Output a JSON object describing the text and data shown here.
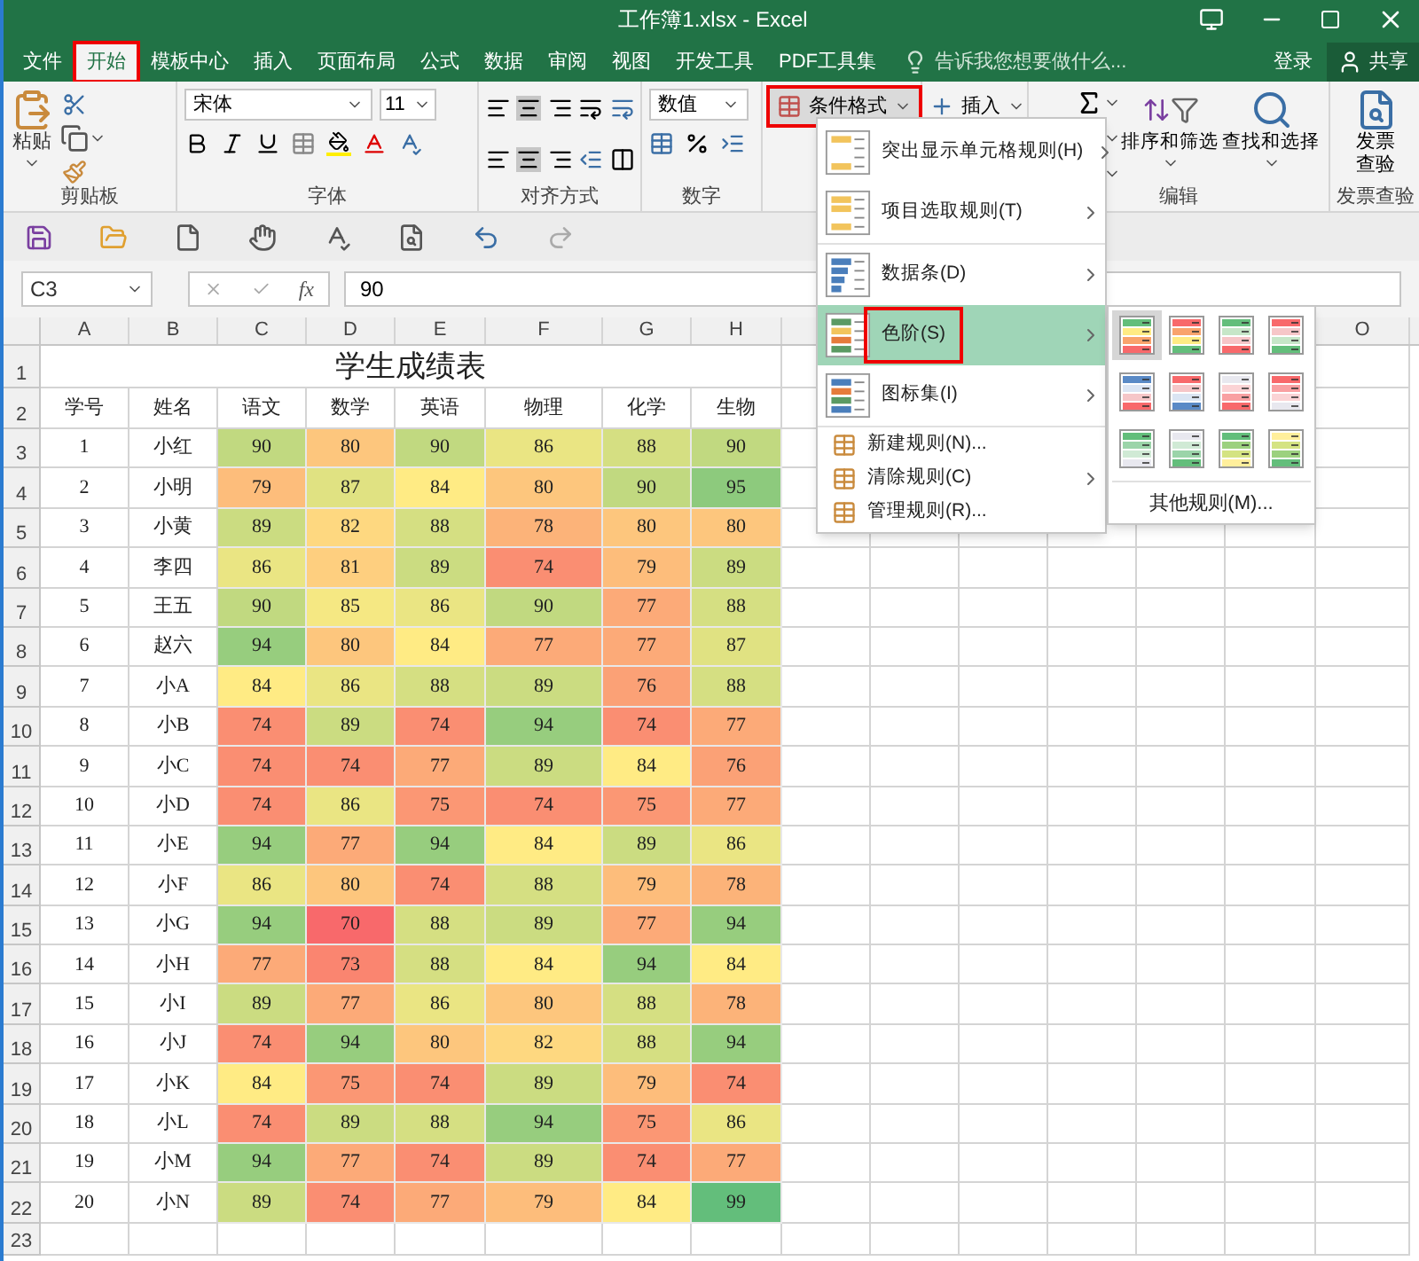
{
  "window": {
    "title": "工作簿1.xlsx - Excel"
  },
  "tabs": [
    {
      "label": "文件",
      "selected": false,
      "annotated": false
    },
    {
      "label": "开始",
      "selected": true,
      "annotated": true
    },
    {
      "label": "模板中心",
      "selected": false,
      "annotated": false
    },
    {
      "label": "插入",
      "selected": false,
      "annotated": false
    },
    {
      "label": "页面布局",
      "selected": false,
      "annotated": false
    },
    {
      "label": "公式",
      "selected": false,
      "annotated": false
    },
    {
      "label": "数据",
      "selected": false,
      "annotated": false
    },
    {
      "label": "审阅",
      "selected": false,
      "annotated": false
    },
    {
      "label": "视图",
      "selected": false,
      "annotated": false
    },
    {
      "label": "开发工具",
      "selected": false,
      "annotated": false
    },
    {
      "label": "PDF工具集",
      "selected": false,
      "annotated": false
    }
  ],
  "tell_me": {
    "placeholder": "告诉我您想要做什么..."
  },
  "account": {
    "sign_in": "登录",
    "share": "共享"
  },
  "ribbon": {
    "paste": "粘贴",
    "font_name": "宋体",
    "font_size": "11",
    "number_format": "数值",
    "conditional_formatting": {
      "label": "条件格式",
      "annotated": true
    },
    "insert": "插入",
    "sort_filter": "排序和筛选",
    "find_select": "查找和选择",
    "invoice_check": "发票查验",
    "groups": [
      "剪贴板",
      "字体",
      "对齐方式",
      "数字",
      "编辑",
      "发票查验"
    ]
  },
  "formula_bar": {
    "name_box": "C3",
    "fx": "fx",
    "value": "90"
  },
  "sheet": {
    "column_headers": [
      "A",
      "B",
      "C",
      "D",
      "E",
      "F",
      "G",
      "H",
      "O"
    ],
    "row_headers": [
      "1",
      "2",
      "3",
      "4",
      "5",
      "6",
      "7",
      "8",
      "9",
      "10",
      "11",
      "12",
      "13",
      "14",
      "15",
      "16",
      "17",
      "18",
      "19",
      "20",
      "21",
      "22",
      "23"
    ],
    "title": "学生成绩表",
    "header": [
      "学号",
      "姓名",
      "语文",
      "数学",
      "英语",
      "物理",
      "化学",
      "生物"
    ],
    "rows": [
      [
        "1",
        "小红",
        "90",
        "80",
        "90",
        "86",
        "88",
        "90"
      ],
      [
        "2",
        "小明",
        "79",
        "87",
        "84",
        "80",
        "90",
        "95"
      ],
      [
        "3",
        "小黄",
        "89",
        "82",
        "88",
        "78",
        "80",
        "80"
      ],
      [
        "4",
        "李四",
        "86",
        "81",
        "89",
        "74",
        "79",
        "89"
      ],
      [
        "5",
        "王五",
        "90",
        "85",
        "86",
        "90",
        "77",
        "88"
      ],
      [
        "6",
        "赵六",
        "94",
        "80",
        "84",
        "77",
        "77",
        "87"
      ],
      [
        "7",
        "小A",
        "84",
        "86",
        "88",
        "89",
        "76",
        "88"
      ],
      [
        "8",
        "小B",
        "74",
        "89",
        "74",
        "94",
        "74",
        "77"
      ],
      [
        "9",
        "小C",
        "74",
        "74",
        "77",
        "89",
        "84",
        "76"
      ],
      [
        "10",
        "小D",
        "74",
        "86",
        "75",
        "74",
        "75",
        "77"
      ],
      [
        "11",
        "小E",
        "94",
        "77",
        "94",
        "84",
        "89",
        "86"
      ],
      [
        "12",
        "小F",
        "86",
        "80",
        "74",
        "88",
        "79",
        "78"
      ],
      [
        "13",
        "小G",
        "94",
        "70",
        "88",
        "89",
        "77",
        "94"
      ],
      [
        "14",
        "小H",
        "77",
        "73",
        "88",
        "84",
        "94",
        "84"
      ],
      [
        "15",
        "小I",
        "89",
        "77",
        "86",
        "80",
        "88",
        "78"
      ],
      [
        "16",
        "小J",
        "74",
        "94",
        "80",
        "82",
        "88",
        "94"
      ],
      [
        "17",
        "小K",
        "84",
        "75",
        "74",
        "89",
        "79",
        "74"
      ],
      [
        "18",
        "小L",
        "74",
        "89",
        "88",
        "94",
        "75",
        "86"
      ],
      [
        "19",
        "小M",
        "94",
        "77",
        "74",
        "89",
        "74",
        "77"
      ],
      [
        "20",
        "小N",
        "89",
        "74",
        "77",
        "79",
        "84",
        "99"
      ]
    ]
  },
  "menu": {
    "items": [
      {
        "kind": "large",
        "label": "突出显示单元格规则(H)",
        "submenu": true,
        "selected": false,
        "annotated": false
      },
      {
        "kind": "large",
        "label": "项目选取规则(T)",
        "submenu": true,
        "selected": false,
        "annotated": false
      },
      {
        "kind": "large",
        "label": "数据条(D)",
        "submenu": true,
        "selected": false,
        "annotated": false
      },
      {
        "kind": "large",
        "label": "色阶(S)",
        "submenu": true,
        "selected": true,
        "annotated": true
      },
      {
        "kind": "large",
        "label": "图标集(I)",
        "submenu": true,
        "selected": false,
        "annotated": false
      },
      {
        "kind": "small",
        "label": "新建规则(N)...",
        "submenu": false,
        "selected": false,
        "annotated": false
      },
      {
        "kind": "small",
        "label": "清除规则(C)",
        "submenu": true,
        "selected": false,
        "annotated": false
      },
      {
        "kind": "small",
        "label": "管理规则(R)...",
        "submenu": false,
        "selected": false,
        "annotated": false
      }
    ]
  },
  "color_scales": {
    "swatches": [
      {
        "selected": true
      },
      {
        "selected": false
      },
      {
        "selected": false
      },
      {
        "selected": false
      },
      {
        "selected": false
      },
      {
        "selected": false
      },
      {
        "selected": false
      },
      {
        "selected": false
      },
      {
        "selected": false
      },
      {
        "selected": false
      },
      {
        "selected": false
      },
      {
        "selected": false
      }
    ],
    "more": "其他规则(M)..."
  }
}
